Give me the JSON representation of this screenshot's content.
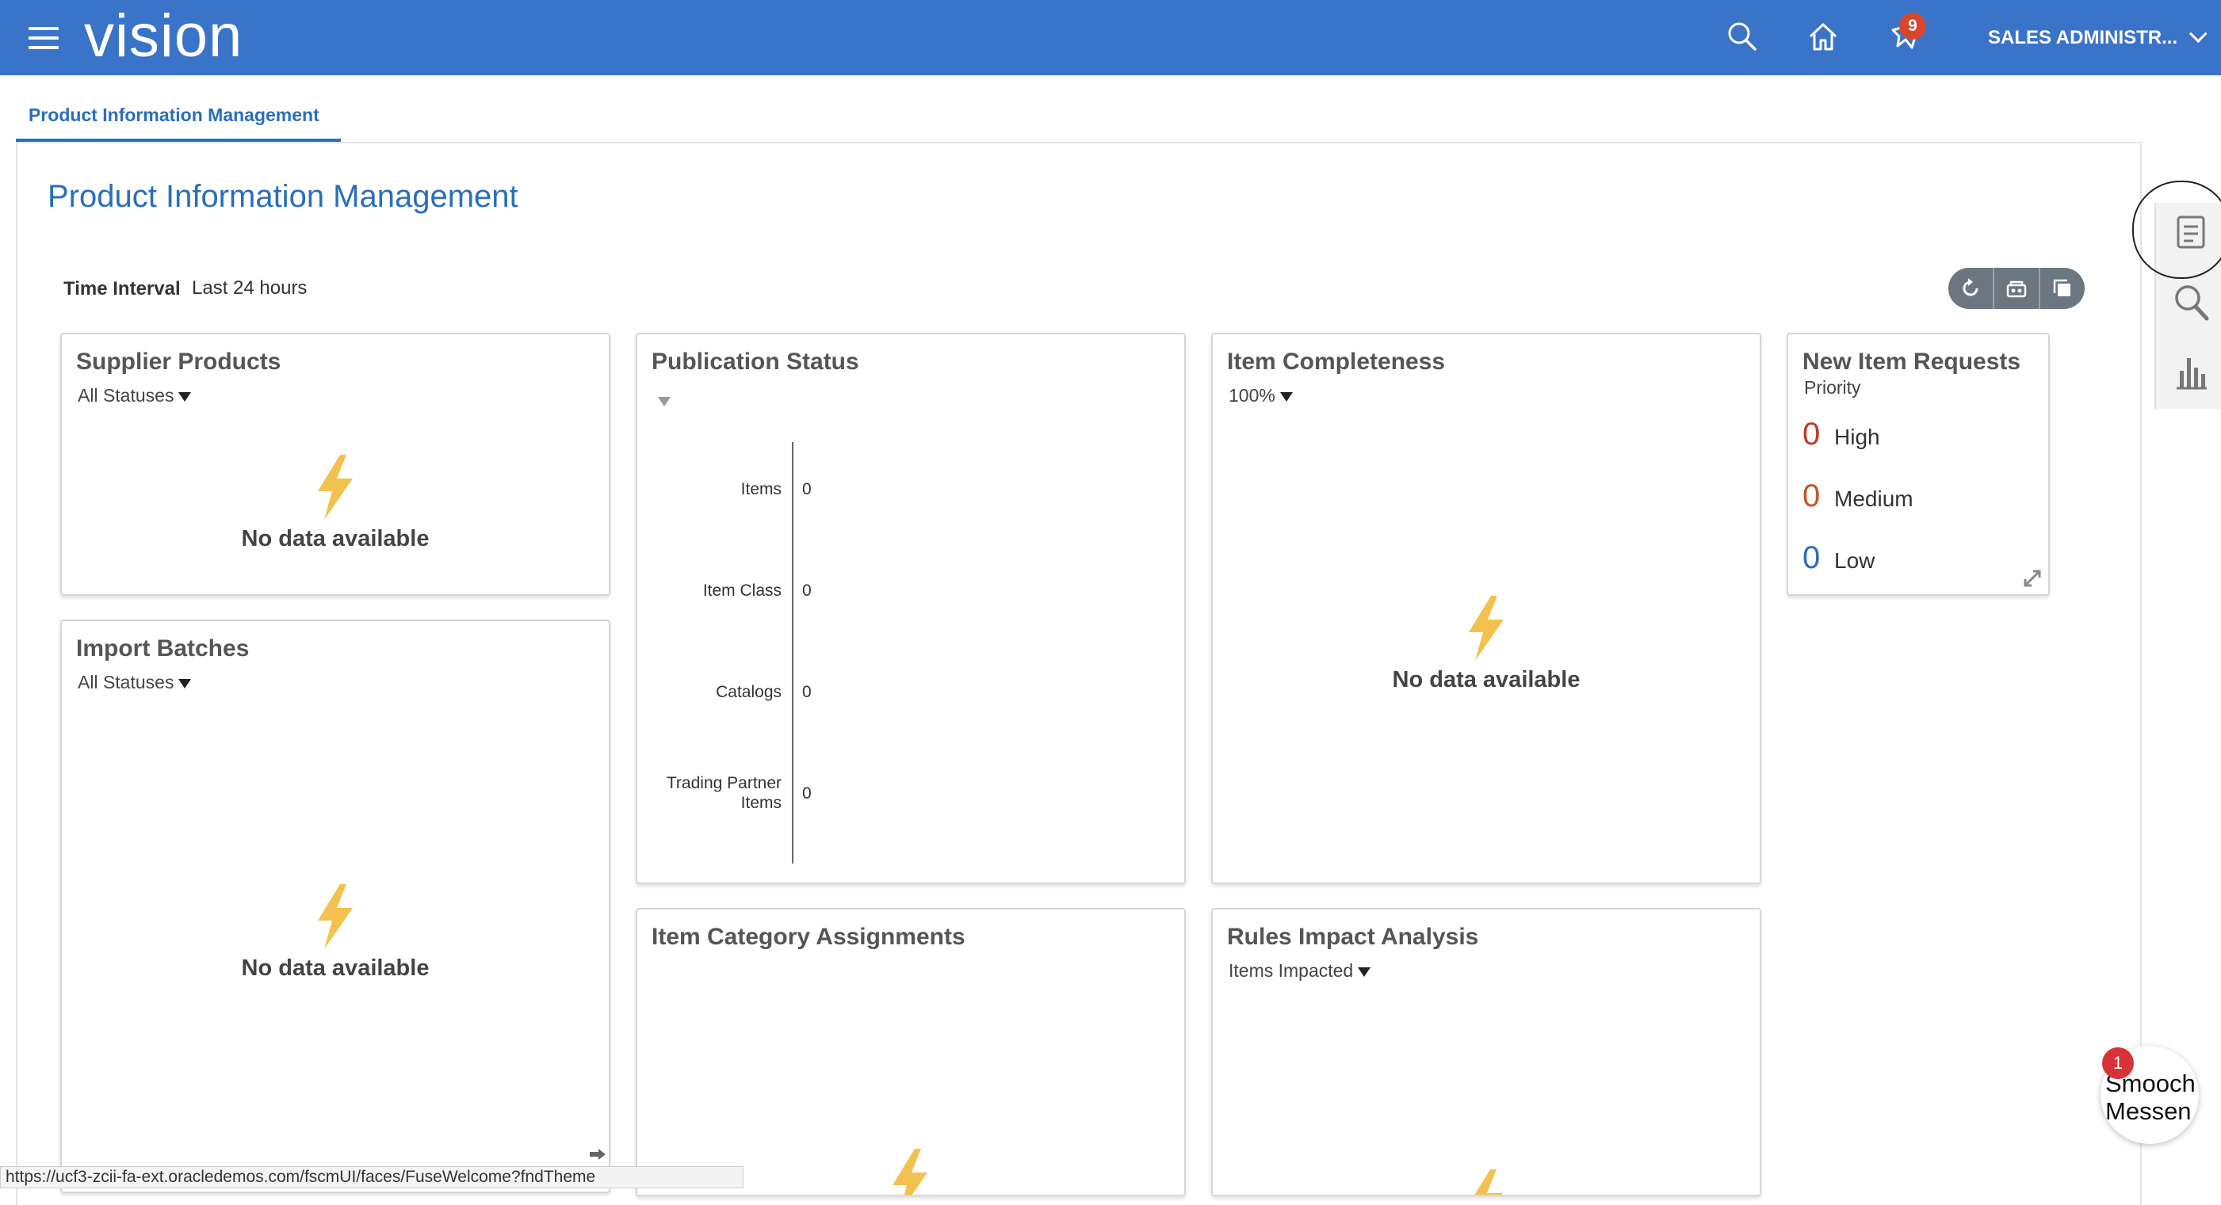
{
  "header": {
    "logo": "vision",
    "notifications_count": "9",
    "user_menu_label": "SALES ADMINISTR...",
    "bar_color": "#3a74c8"
  },
  "tabs": [
    {
      "label": "Product Information Management",
      "active": true
    }
  ],
  "page": {
    "title": "Product Information Management",
    "time_interval_label": "Time Interval",
    "time_interval_value": "Last 24 hours"
  },
  "cards": {
    "supplier_products": {
      "title": "Supplier Products",
      "filter": "All Statuses",
      "empty_text": "No data available"
    },
    "import_batches": {
      "title": "Import Batches",
      "filter": "All Statuses",
      "empty_text": "No data available"
    },
    "publication_status": {
      "title": "Publication Status",
      "rows": [
        {
          "label": "Items",
          "value": "0"
        },
        {
          "label": "Item Class",
          "value": "0"
        },
        {
          "label": "Catalogs",
          "value": "0"
        },
        {
          "label": "Trading Partner Items",
          "value": "0"
        }
      ]
    },
    "item_category_assignments": {
      "title": "Item Category Assignments"
    },
    "item_completeness": {
      "title": "Item Completeness",
      "filter": "100%",
      "empty_text": "No data available"
    },
    "rules_impact_analysis": {
      "title": "Rules Impact Analysis",
      "filter": "Items Impacted"
    },
    "new_item_requests": {
      "title": "New Item Requests",
      "subtitle": "Priority",
      "rows": [
        {
          "count": "0",
          "label": "High",
          "color": "#c0392b"
        },
        {
          "count": "0",
          "label": "Medium",
          "color": "#c0562b"
        },
        {
          "count": "0",
          "label": "Low",
          "color": "#2a6ebb"
        }
      ]
    }
  },
  "statusbar": {
    "url": "https://ucf3-zcii-fa-ext.oracledemos.com/fscmUI/faces/FuseWelcome?fndTheme"
  },
  "chat": {
    "label_line1": "Smooch",
    "label_line2": "Messen",
    "badge": "1"
  },
  "icons": {
    "menu": "hamburger-icon",
    "search": "search-icon",
    "home": "home-icon",
    "notifications": "notifications-icon",
    "refresh": "refresh-icon",
    "customize": "customize-icon",
    "copy": "copy-icon",
    "tasks": "tasks-icon",
    "chart": "bar-chart-icon",
    "no_data": "lightning-icon",
    "expand": "expand-icon"
  }
}
